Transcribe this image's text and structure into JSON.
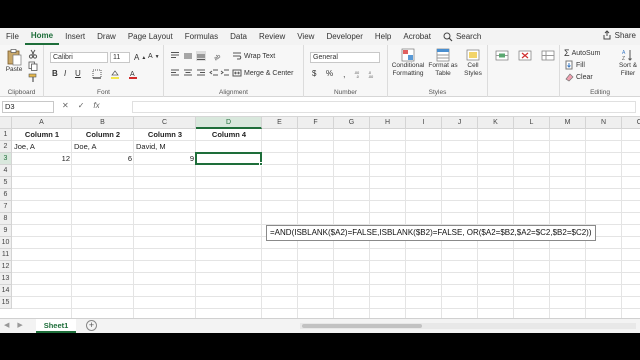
{
  "ribbon_tabs": [
    "File",
    "Home",
    "Insert",
    "Draw",
    "Page Layout",
    "Formulas",
    "Data",
    "Review",
    "View",
    "Developer",
    "Help",
    "Acrobat"
  ],
  "active_tab": "Home",
  "search_label": "Search",
  "share_label": "Share",
  "clipboard": {
    "paste_label": "Paste",
    "group_label": "Clipboard"
  },
  "font": {
    "name": "Calibri",
    "size": "11",
    "bold": "B",
    "italic": "I",
    "underline": "U",
    "group_label": "Font"
  },
  "alignment": {
    "wrap_text": "Wrap Text",
    "merge_center": "Merge & Center",
    "group_label": "Alignment"
  },
  "number": {
    "format": "General",
    "currency": "$",
    "percent": "%",
    "group_label": "Number"
  },
  "styles": {
    "conditional": "Conditional Formatting",
    "format_table": "Format as Table",
    "cell_styles": "Cell Styles",
    "group_label": "Styles"
  },
  "cells": {
    "A1": "Column 1",
    "B1": "Column 2",
    "C1": "Column 3",
    "D1": "Column 4",
    "A2": "Joe, A",
    "B2": "Doe, A",
    "C2": "David, M",
    "A3": "12",
    "B3": "6",
    "C3": "9"
  },
  "editing": {
    "autosum": "AutoSum",
    "fill": "Fill",
    "clear": "Clear",
    "sort_filter": "Sort & Filter",
    "group_label": "Editing"
  },
  "name_box": "D3",
  "fx_symbol": "fx",
  "columns": [
    "A",
    "B",
    "C",
    "D",
    "E",
    "F",
    "G",
    "H",
    "I",
    "J",
    "K",
    "L",
    "M",
    "N",
    "O"
  ],
  "selected_column": "D",
  "rows": [
    "1",
    "2",
    "3",
    "4",
    "5",
    "6",
    "7",
    "8",
    "9",
    "10",
    "11",
    "12",
    "13",
    "14",
    "15"
  ],
  "selected_row": "3",
  "floating_formula": "=AND(ISBLANK($A2)=FALSE,ISBLANK($B2)=FALSE, OR($A2=$B2,$A2=$C2,$B2=$C2))",
  "sheet_tab": "Sheet1"
}
